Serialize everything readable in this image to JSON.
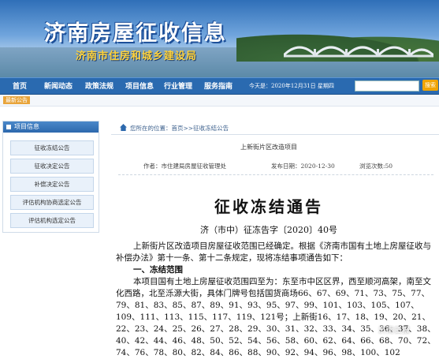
{
  "header": {
    "title": "济南房屋征收信息",
    "subtitle": "济南市住房和城乡建设局"
  },
  "nav": {
    "items": [
      "首页",
      "新闻动态",
      "政策法规",
      "项目信息",
      "行业管理",
      "服务指南"
    ],
    "date": "今天是：2020年12月31日 星期四",
    "search_button": "搜索"
  },
  "notice": {
    "tag": "最新公告"
  },
  "sidebar": {
    "heading": "项目信息",
    "items": [
      "征收冻结公告",
      "征收决定公告",
      "补偿决定公告",
      "评估机构协商选定公告",
      "评估机构选定公告"
    ]
  },
  "breadcrumb": "您所在的位置：首页>>征收冻结公告",
  "article": {
    "small_title": "上新街片区改造项目",
    "author": "作者：市住建局房屋征收管理处",
    "date": "发布日期：2020-12-30",
    "views": "浏览次数:50",
    "title": "征收冻结通告",
    "doc_no": "济（市中）征冻告字〔2020〕40号",
    "para1": "上新街片区改造项目房屋征收范围已经确定。根据《济南市国有土地上房屋征收与补偿办法》第十一条、第十二条规定，现将冻结事项通告如下：",
    "section1": "一、冻结范围",
    "para2": "本项目国有土地上房屋征收范围四至为：东至市中区区界，西至顺河高架，南至文化西路，北至泺源大街，具体门牌号包括国货商场66、67、69、71、73、75、77、79、81、83、85、87、89、91、93、95、97、99、101、103、105、107、109、111、113、115、117、119、121号；上新街16、17、18、19、20、21、22、23、24、25、26、27、28、29、30、31、32、33、34、35、36、37、38、40、42、44、46、48、50、52、54、56、58、60、62、64、66、68、70、72、74、76、78、80、82、84、86、88、90、92、94、96、98、100、102"
  },
  "watermark": "济南日报",
  "colors": {
    "nav": "#2a6ab0",
    "accent": "#f0a400",
    "title_white": "#ffffff",
    "subtitle_yellow": "#ffd23a"
  }
}
